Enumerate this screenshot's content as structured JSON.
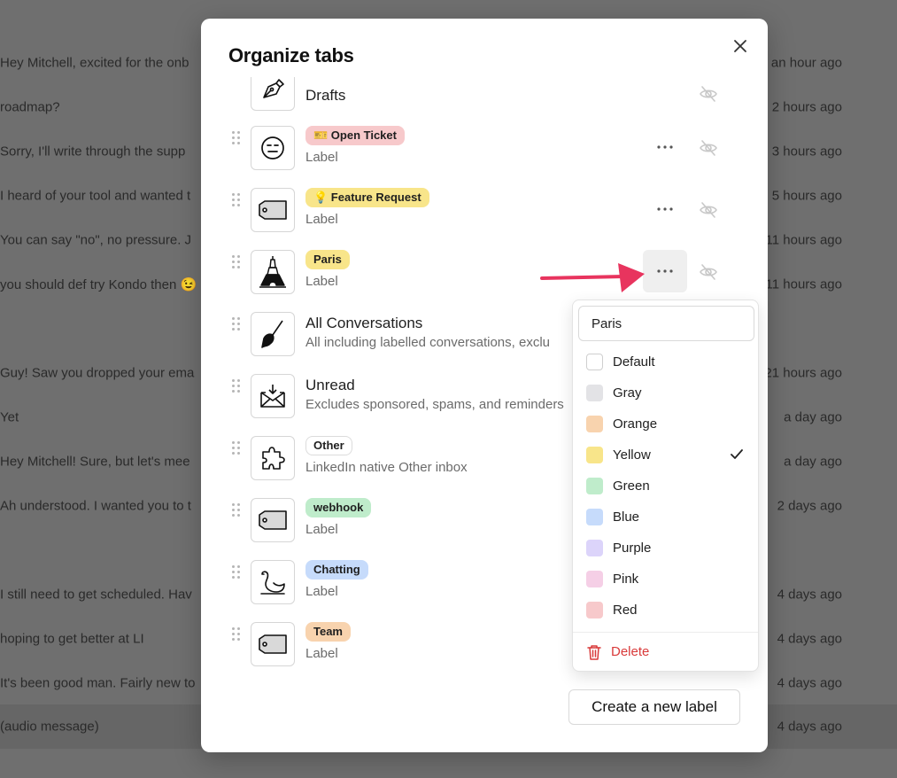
{
  "background": {
    "rows": [
      {
        "snippet": "Hey Mitchell, excited for the onb",
        "time": "an hour ago"
      },
      {
        "snippet": "roadmap?",
        "time": "2 hours ago"
      },
      {
        "snippet": "Sorry, I'll write through the supp",
        "time": "3 hours ago"
      },
      {
        "snippet": "I heard of your tool and wanted t",
        "time": "5 hours ago"
      },
      {
        "snippet": "You can say \"no\", no pressure. J",
        "time": "11 hours ago"
      },
      {
        "snippet": "you should def try Kondo then 😉",
        "time": "11 hours ago"
      },
      {
        "snippet": "Guy! Saw you dropped your ema",
        "time": "21 hours ago"
      },
      {
        "snippet": "Yet",
        "time": "a day ago"
      },
      {
        "snippet": "Hey Mitchell! Sure, but let's mee",
        "time": "a day ago"
      },
      {
        "snippet": "Ah understood. I wanted you to t",
        "time": "2 days ago"
      },
      {
        "snippet": "I still need to get scheduled. Hav",
        "time": "4 days ago"
      },
      {
        "snippet": "hoping to get better at LI",
        "time": "4 days ago"
      },
      {
        "snippet": "It's been good man. Fairly new to",
        "time": "4 days ago"
      },
      {
        "snippet": "(audio message)",
        "time": "4 days ago"
      }
    ]
  },
  "modal": {
    "title": "Organize tabs",
    "create_label": "Create a new label",
    "tabs": [
      {
        "name": "Drafts",
        "icon": "pen-nib-icon"
      },
      {
        "name": "🎫 Open Ticket",
        "sub": "Label",
        "icon": "neutral-face-icon",
        "color": "#f7c9cb"
      },
      {
        "name": "💡 Feature Request",
        "sub": "Label",
        "icon": "tag-icon",
        "color": "#f8e58a"
      },
      {
        "name": "Paris",
        "sub": "Label",
        "icon": "eiffel-tower-icon",
        "color": "#f8e58a"
      },
      {
        "name": "All Conversations",
        "sub": "All including labelled conversations, exclu",
        "icon": "broom-icon"
      },
      {
        "name": "Unread",
        "sub": "Excludes sponsored, spams, and reminders",
        "icon": "inbox-envelope-icon"
      },
      {
        "name": "Other",
        "sub": "LinkedIn native Other inbox",
        "icon": "puzzle-icon",
        "color": "#ffffff"
      },
      {
        "name": "webhook",
        "sub": "Label",
        "icon": "tag-icon",
        "color": "#bfeccb"
      },
      {
        "name": "Chatting",
        "sub": "Label",
        "icon": "swan-icon",
        "color": "#c6dbfb"
      },
      {
        "name": "Team",
        "sub": "Label",
        "icon": "tag-icon",
        "color": "#f8d3ae"
      }
    ]
  },
  "dropdown": {
    "input_value": "Paris",
    "selected": "Yellow",
    "colors": [
      {
        "label": "Default",
        "hex": "#ffffff"
      },
      {
        "label": "Gray",
        "hex": "#e3e3e6"
      },
      {
        "label": "Orange",
        "hex": "#f8d3ae"
      },
      {
        "label": "Yellow",
        "hex": "#f8e58a"
      },
      {
        "label": "Green",
        "hex": "#bfeccb"
      },
      {
        "label": "Blue",
        "hex": "#c6dbfb"
      },
      {
        "label": "Purple",
        "hex": "#dcd4fa"
      },
      {
        "label": "Pink",
        "hex": "#f5cfe6"
      },
      {
        "label": "Red",
        "hex": "#f7c9cb"
      }
    ],
    "delete_label": "Delete"
  },
  "colors": {
    "accent_arrow": "#e8345e",
    "danger": "#d93a3a"
  }
}
